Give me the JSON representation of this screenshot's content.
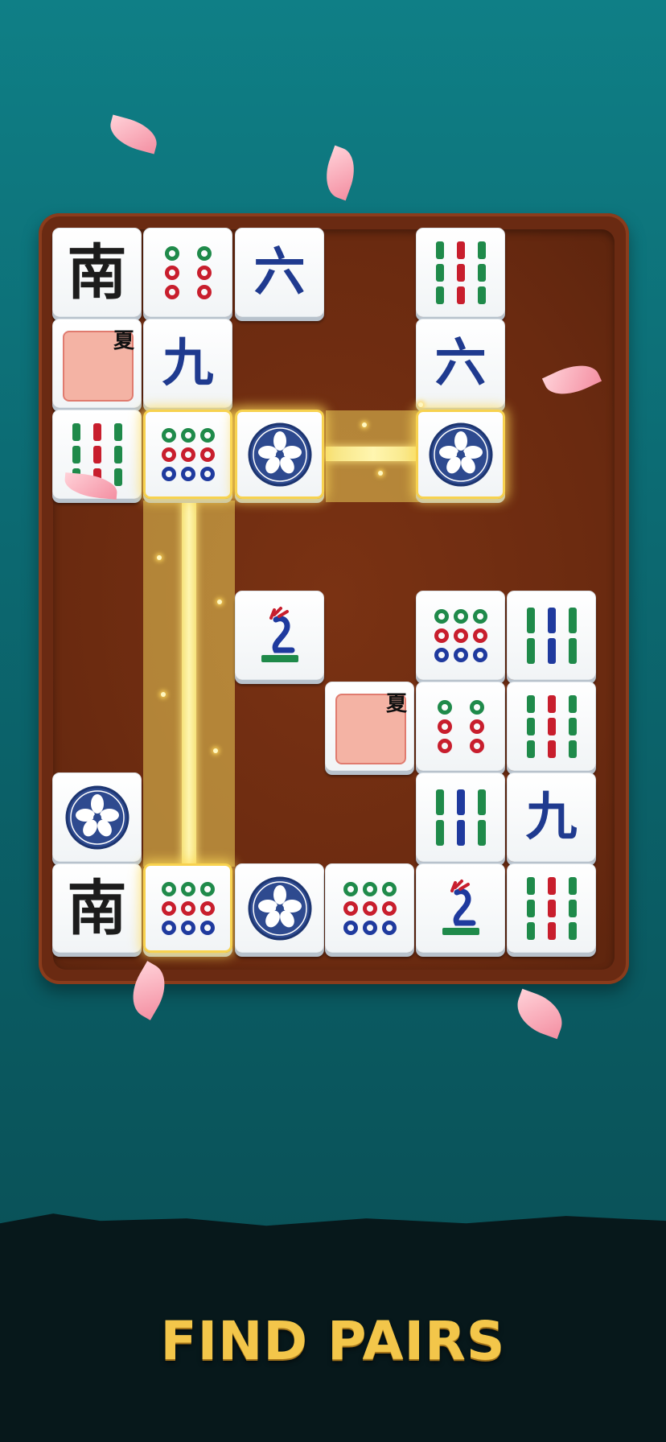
{
  "title": "FIND PAIRS",
  "tiles": [
    {
      "id": "t1",
      "kind": "char",
      "glyph": "南",
      "color": "black",
      "name": "south-wind-tile",
      "selected": false
    },
    {
      "id": "t2",
      "kind": "dots",
      "count": 6,
      "name": "six-dots-tile",
      "selected": false
    },
    {
      "id": "t3",
      "kind": "char",
      "glyph": "六",
      "color": "blue",
      "name": "six-character-tile",
      "selected": false
    },
    {
      "id": "t4",
      "kind": "bamboo",
      "count": 9,
      "name": "nine-bamboo-tile",
      "selected": false
    },
    {
      "id": "t5",
      "kind": "season",
      "glyph": "夏",
      "name": "summer-flower-tile",
      "selected": false
    },
    {
      "id": "t6",
      "kind": "char",
      "glyph": "九",
      "color": "blue",
      "name": "nine-character-tile",
      "selected": false
    },
    {
      "id": "t7",
      "kind": "char",
      "glyph": "六",
      "color": "blue",
      "name": "six-character-tile",
      "selected": false
    },
    {
      "id": "t8",
      "kind": "bamboo",
      "count": 9,
      "name": "nine-bamboo-tile",
      "selected": false
    },
    {
      "id": "t9",
      "kind": "dots",
      "count": 9,
      "name": "nine-dots-tile",
      "selected": true
    },
    {
      "id": "t10",
      "kind": "orchid",
      "glyph": "兰",
      "name": "orchid-flower-tile",
      "selected": true
    },
    {
      "id": "t11",
      "kind": "orchid",
      "glyph": "兰",
      "name": "orchid-flower-tile",
      "selected": true
    },
    {
      "id": "t12",
      "kind": "bird",
      "name": "one-bamboo-bird-tile",
      "selected": false
    },
    {
      "id": "t13",
      "kind": "dots",
      "count": 9,
      "name": "nine-dots-tile",
      "selected": false
    },
    {
      "id": "t14",
      "kind": "bamboo",
      "count": 6,
      "name": "six-bamboo-tile",
      "selected": false
    },
    {
      "id": "t15",
      "kind": "season",
      "glyph": "夏",
      "name": "summer-flower-tile",
      "selected": false
    },
    {
      "id": "t16",
      "kind": "dots",
      "count": 6,
      "name": "six-dots-tile",
      "selected": false
    },
    {
      "id": "t17",
      "kind": "bamboo",
      "count": 9,
      "name": "nine-bamboo-tile",
      "selected": false
    },
    {
      "id": "t18",
      "kind": "orchid",
      "glyph": "兰",
      "name": "orchid-flower-tile",
      "selected": false
    },
    {
      "id": "t19",
      "kind": "bamboo",
      "count": 6,
      "name": "six-bamboo-tile",
      "selected": false
    },
    {
      "id": "t20",
      "kind": "char",
      "glyph": "九",
      "color": "blue",
      "name": "nine-character-tile",
      "selected": false
    },
    {
      "id": "t21",
      "kind": "char",
      "glyph": "南",
      "color": "black",
      "name": "south-wind-tile",
      "selected": false
    },
    {
      "id": "t22",
      "kind": "dots",
      "count": 9,
      "name": "nine-dots-tile",
      "selected": true
    },
    {
      "id": "t23",
      "kind": "orchid",
      "glyph": "兰",
      "name": "orchid-flower-tile",
      "selected": false
    },
    {
      "id": "t24",
      "kind": "dots",
      "count": 9,
      "name": "nine-dots-tile",
      "selected": false
    },
    {
      "id": "t25",
      "kind": "bird",
      "name": "one-bamboo-bird-tile",
      "selected": false
    },
    {
      "id": "t26",
      "kind": "bamboo",
      "count": 9,
      "name": "nine-bamboo-tile",
      "selected": false
    }
  ],
  "colors": {
    "gold": "#f3c64a",
    "felt": "#6a2a12",
    "teal": "#0c6a72"
  }
}
